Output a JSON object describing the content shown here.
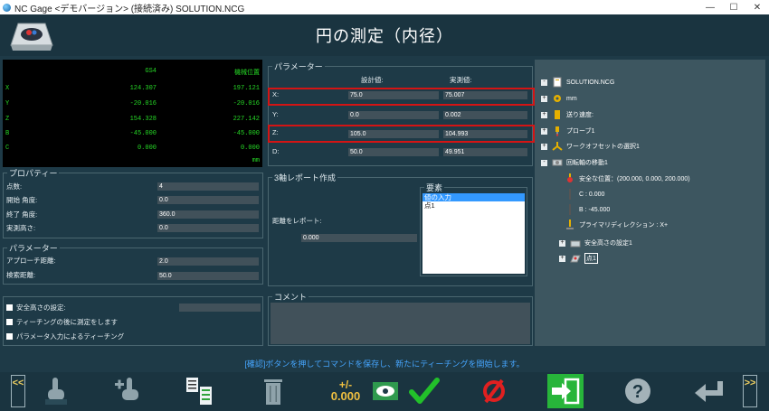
{
  "window": {
    "title": "NC Gage <デモバージョン> (接続済み) SOLUTION.NCG",
    "minimize": "—",
    "maximize": "☐",
    "close": "✕"
  },
  "page": {
    "title": "円の測定（内径）"
  },
  "coords": {
    "head_mid": "GS4",
    "head_right": "機械位置",
    "rows": [
      {
        "axis": "X",
        "work": "124.307",
        "machine": "197.121"
      },
      {
        "axis": "Y",
        "work": "-20.016",
        "machine": "-20.016"
      },
      {
        "axis": "Z",
        "work": "154.328",
        "machine": "227.142"
      },
      {
        "axis": "B",
        "work": "-45.000",
        "machine": "-45.000"
      },
      {
        "axis": "C",
        "work": "0.000",
        "machine": "0.000"
      }
    ],
    "unit": "mm"
  },
  "params": {
    "label": "パラメーター",
    "col_design": "設計値:",
    "col_actual": "実測値:",
    "rows": [
      {
        "label": "X:",
        "design": "75.0",
        "actual": "75.007"
      },
      {
        "label": "Y:",
        "design": "0.0",
        "actual": "0.002"
      },
      {
        "label": "Z:",
        "design": "105.0",
        "actual": "104.993"
      },
      {
        "label": "D:",
        "design": "50.0",
        "actual": "49.951"
      }
    ]
  },
  "properties": {
    "label": "プロパティー",
    "rows": [
      {
        "label": "点数:",
        "value": "4"
      },
      {
        "label": "開始 角度:",
        "value": "0.0"
      },
      {
        "label": "終了 角度:",
        "value": "360.0"
      },
      {
        "label": "実測高さ:",
        "value": "0.0"
      }
    ]
  },
  "approach": {
    "label": "パラメーター",
    "rows": [
      {
        "label": "アプローチ距離:",
        "value": "2.0"
      },
      {
        "label": "検索距離:",
        "value": "50.0"
      }
    ]
  },
  "options": {
    "safe_height": "安全高さの設定:",
    "teach_after": "ティーチングの後に測定をします",
    "param_teach": "パラメータ入力によるティーチング"
  },
  "report": {
    "label": "3軸レポート作成",
    "distance_label": "距離をレポート:",
    "distance_value": "0.000",
    "elements_label": "要素",
    "elements": [
      "値の入力",
      "点1"
    ]
  },
  "comment": {
    "label": "コメント"
  },
  "tree": {
    "items": [
      {
        "label": "SOLUTION.NCG"
      },
      {
        "label": "mm"
      },
      {
        "label": "送り速度:"
      },
      {
        "label": "プローブ1"
      },
      {
        "label": "ワークオフセットの選択1"
      },
      {
        "label": "回転軸の移動1"
      },
      {
        "label": "安全な位置：(200.000, 0.000, 200.000)"
      },
      {
        "label": "C : 0.000"
      },
      {
        "label": "B : -45.000"
      },
      {
        "label": "プライマリディレクション : X+"
      },
      {
        "label": "安全高さの設定1"
      },
      {
        "label": "点1"
      }
    ]
  },
  "status": {
    "message": "[確認]ボタンを押してコマンドを保存し、新たにティーチングを開始します。"
  },
  "toolbar": {
    "prev": "<<",
    "next": ">>",
    "offset_sign": "+/-",
    "offset_value": "0.000"
  },
  "colors": {
    "accent_green": "#26d926",
    "highlight_red": "#d41414",
    "status_blue": "#46a6ff"
  }
}
